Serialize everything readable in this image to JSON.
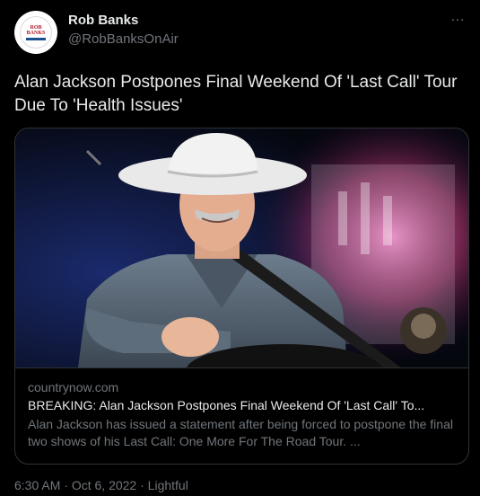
{
  "author": {
    "display_name": "Rob Banks",
    "handle": "@RobBanksOnAir",
    "avatar_logo_top": "ROB",
    "avatar_logo_bottom": "BANKS"
  },
  "more_icon": "…",
  "tweet": {
    "text": "Alan Jackson Postpones Final Weekend Of 'Last Call' Tour Due To 'Health Issues'"
  },
  "card": {
    "domain": "countrynow.com",
    "title": "BREAKING: Alan Jackson Postpones Final Weekend Of 'Last Call' To...",
    "description": "Alan Jackson has issued a statement after being forced to postpone the final two shows of his Last Call: One More For The Road Tour.  ..."
  },
  "meta": {
    "time": "6:30 AM",
    "date": "Oct 6, 2022",
    "source": "Lightful",
    "separator": "·"
  },
  "colors": {
    "background": "#000000",
    "primary_text": "#e7e9ea",
    "secondary_text": "#71767b",
    "border": "#2f3336"
  }
}
